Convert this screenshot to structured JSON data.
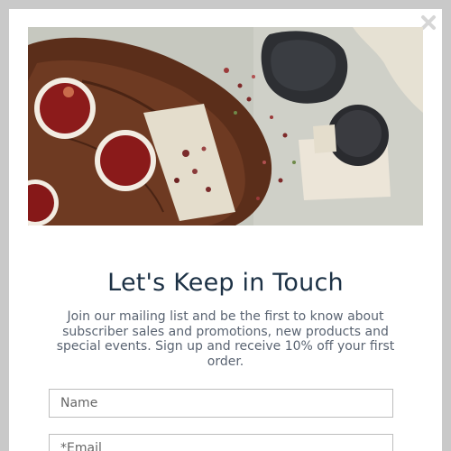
{
  "modal": {
    "title": "Let's Keep in Touch",
    "description": "Join our mailing list and be the first to know about subscriber sales and promotions, new products and special events. Sign up and receive 10% off your first order.",
    "close_icon": "close-x-icon",
    "hero_image": "tea-cups-on-wooden-board-photo"
  },
  "form": {
    "name_placeholder": "Name",
    "email_placeholder": "*Email"
  },
  "colors": {
    "overlay": "#c9c9c9",
    "title": "#1c3145",
    "body_text": "#5a6472",
    "input_border": "#bdbdbd"
  }
}
